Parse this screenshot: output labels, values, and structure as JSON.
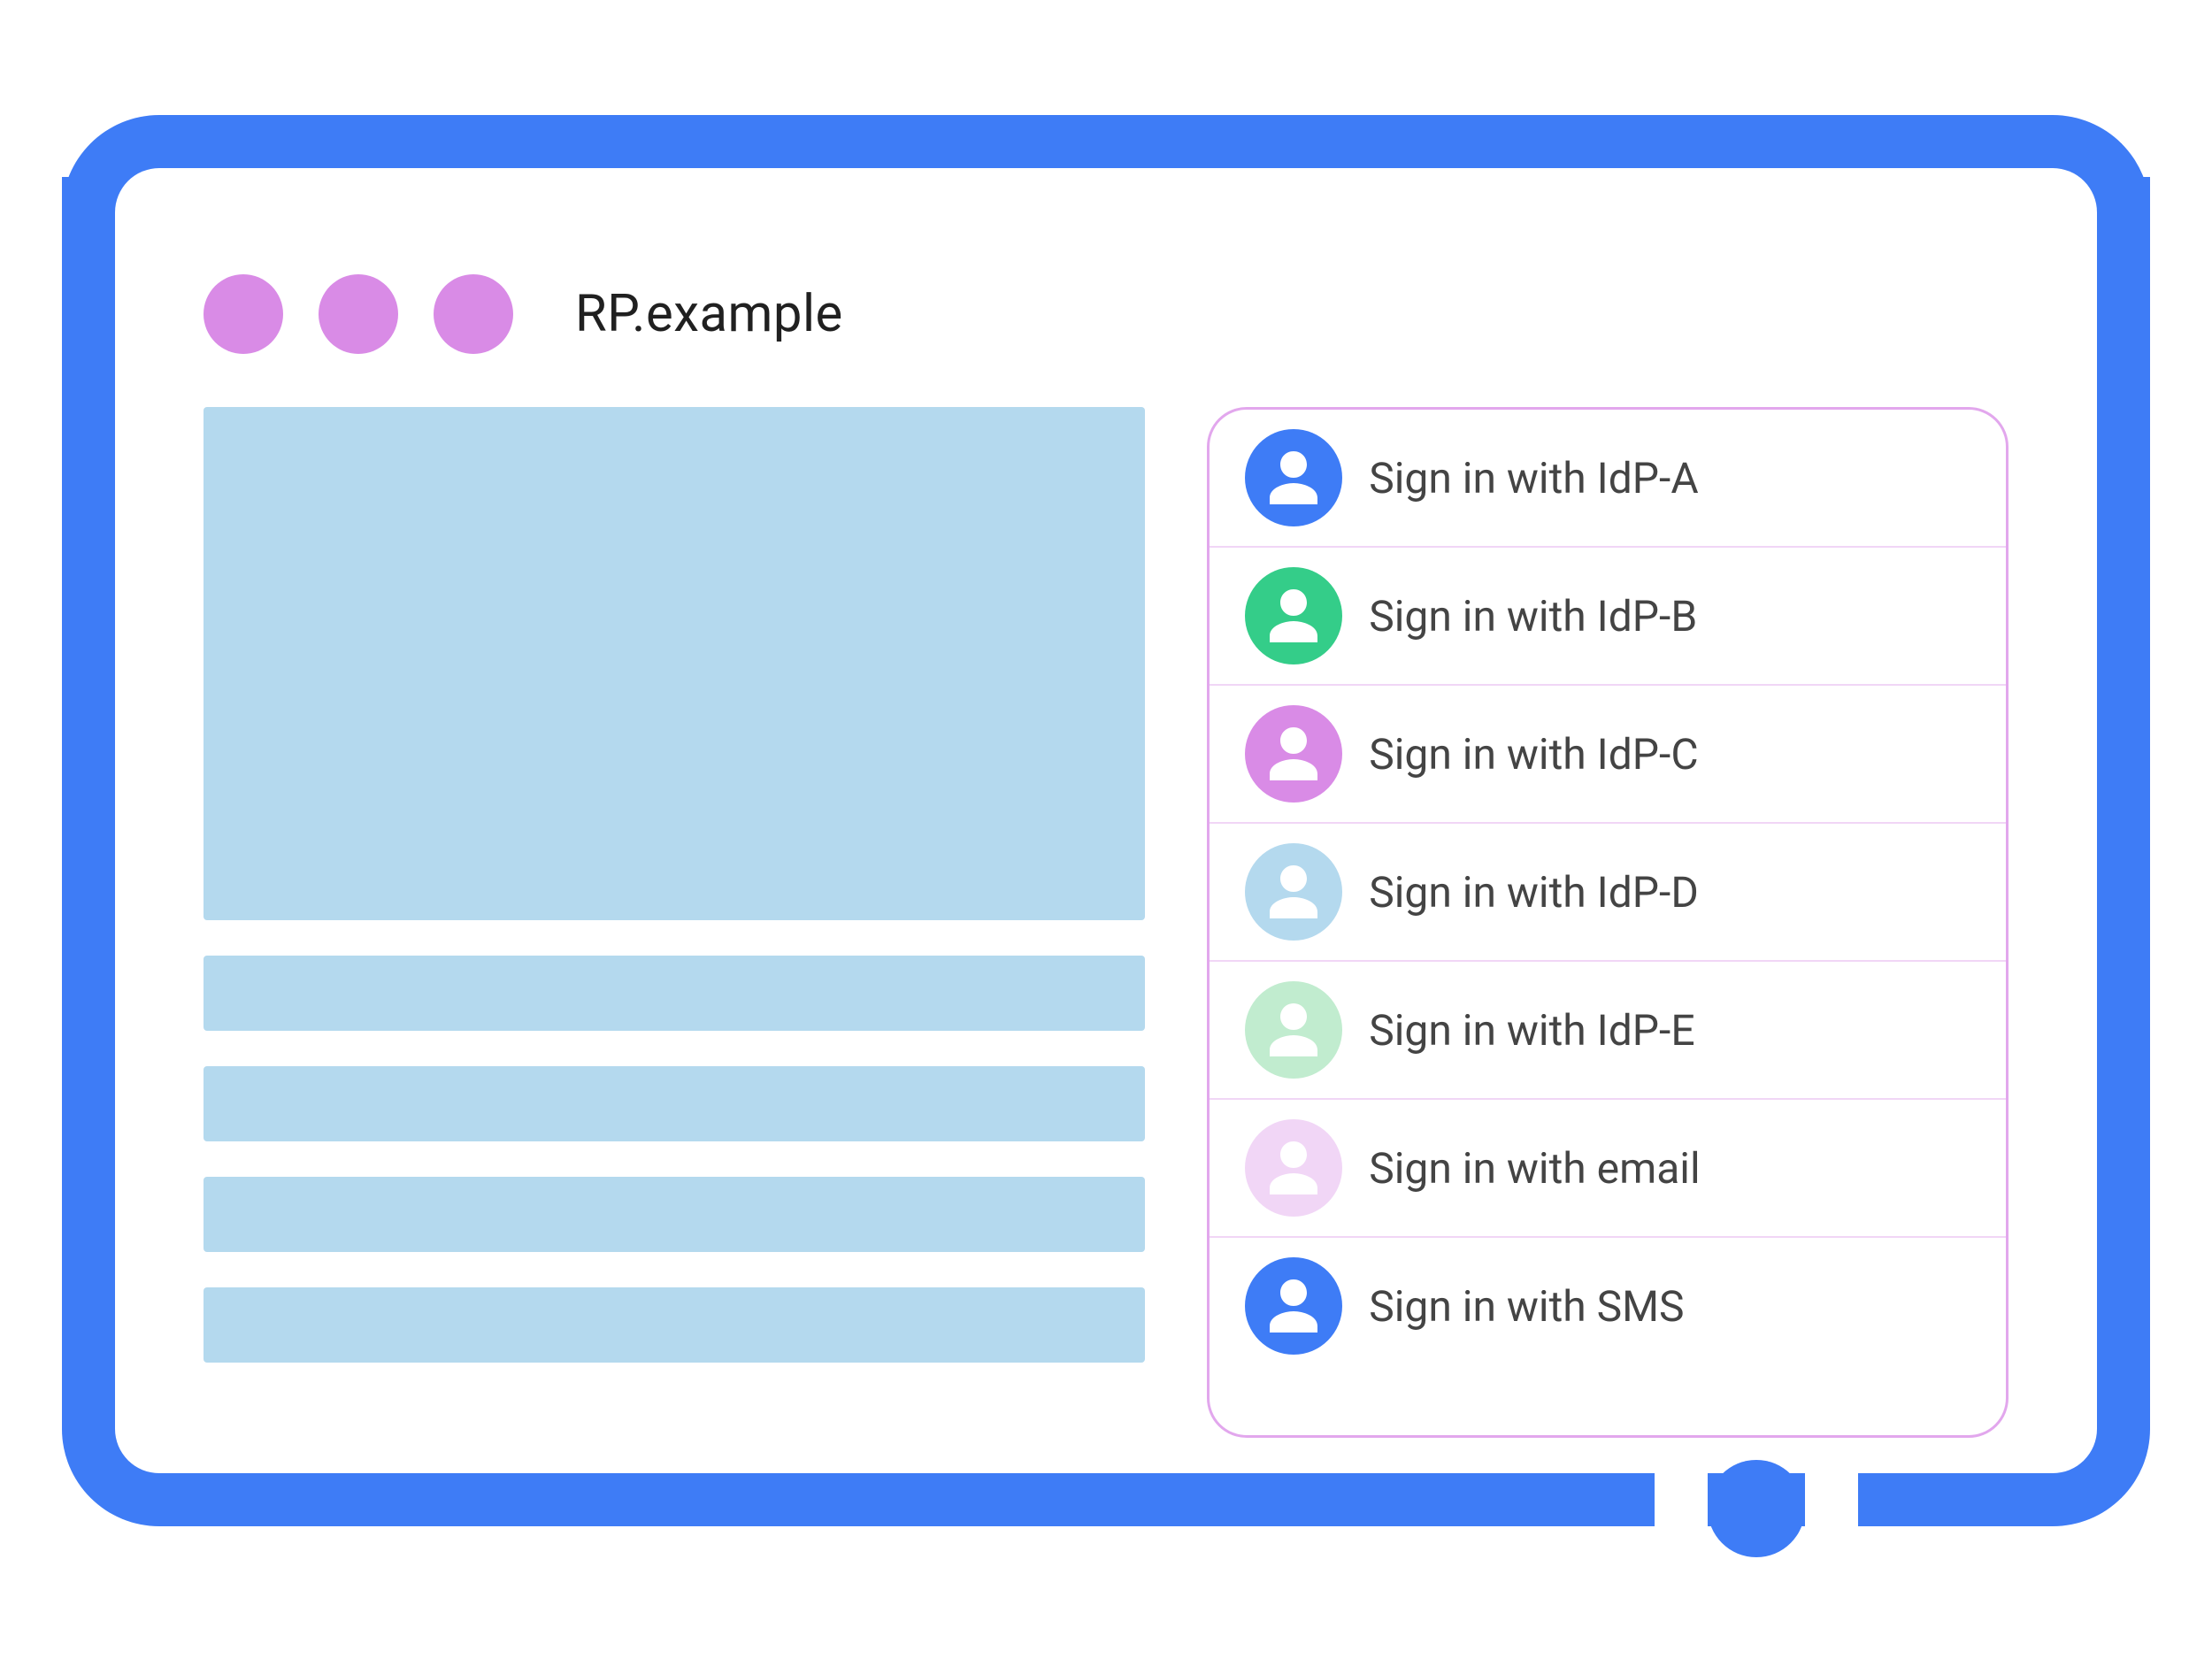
{
  "browser": {
    "url": "RP.example",
    "window_dot_color": "#d98be6"
  },
  "frame": {
    "color": "#3e7cf6"
  },
  "content_placeholder_color": "#b4d9ee",
  "signin": {
    "panel_border_color": "#e2a7ed",
    "options": [
      {
        "label": "Sign in with IdP-A",
        "icon_color": "#3e7cf6"
      },
      {
        "label": "Sign in with IdP-B",
        "icon_color": "#34cd89"
      },
      {
        "label": "Sign in with IdP-C",
        "icon_color": "#d98be6"
      },
      {
        "label": "Sign in with IdP-D",
        "icon_color": "#b4d9ee"
      },
      {
        "label": "Sign in with IdP-E",
        "icon_color": "#c1eccf"
      },
      {
        "label": "Sign in with email",
        "icon_color": "#f1d6f6"
      },
      {
        "label": "Sign in with SMS",
        "icon_color": "#3e7cf6"
      }
    ]
  }
}
